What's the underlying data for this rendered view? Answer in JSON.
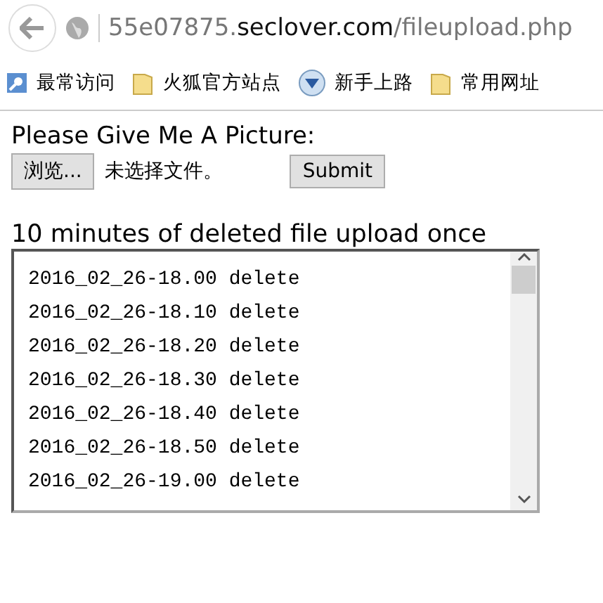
{
  "address_bar": {
    "url_prefix": "55e07875.",
    "url_domain": "seclover.com",
    "url_path": "/fileupload.php"
  },
  "bookmarks": [
    {
      "label": "最常访问",
      "kind": "search"
    },
    {
      "label": "火狐官方站点",
      "kind": "folder"
    },
    {
      "label": "新手上路",
      "kind": "globe"
    },
    {
      "label": "常用网址",
      "kind": "folder"
    }
  ],
  "form": {
    "heading": "Please Give Me A Picture:",
    "browse_button": "浏览...",
    "file_status": "未选择文件。",
    "submit_button": "Submit"
  },
  "log": {
    "heading": "10 minutes of deleted file upload once",
    "lines": [
      "2016_02_26-18.00 delete",
      "2016_02_26-18.10 delete",
      "2016_02_26-18.20 delete",
      "2016_02_26-18.30 delete",
      "2016_02_26-18.40 delete",
      "2016_02_26-18.50 delete",
      "2016_02_26-19.00 delete"
    ]
  }
}
